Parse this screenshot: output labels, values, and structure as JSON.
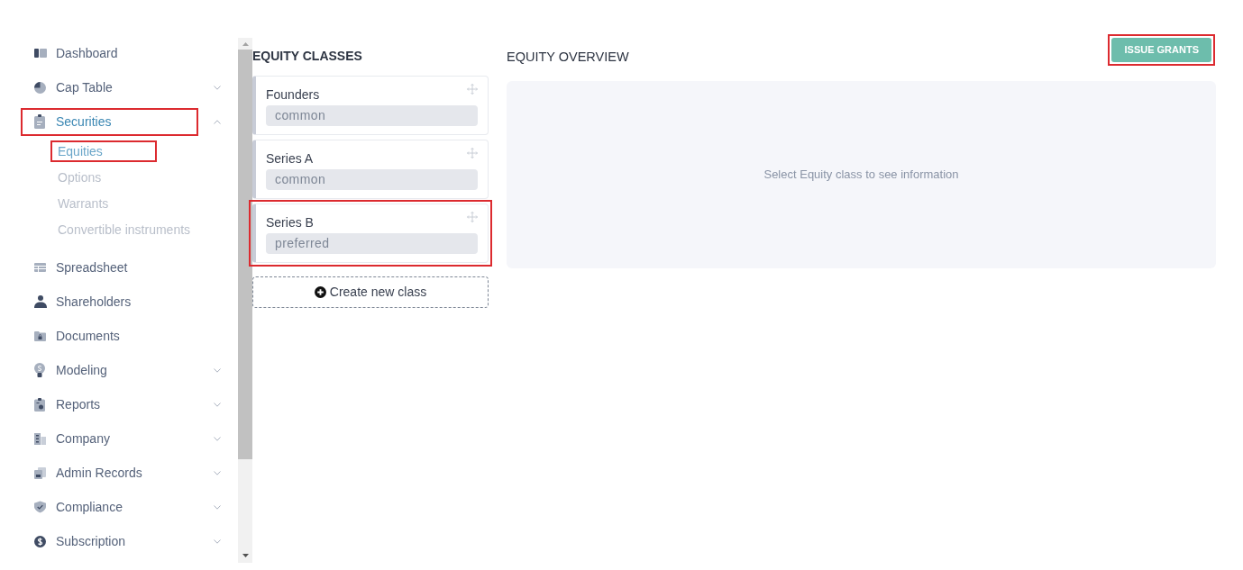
{
  "sidebar": {
    "items": [
      {
        "label": "Dashboard",
        "kind": "link",
        "selected": false,
        "highlighted": false
      },
      {
        "label": "Cap Table",
        "kind": "group",
        "expanded": false,
        "selected": false,
        "highlighted": false
      },
      {
        "label": "Securities",
        "kind": "group",
        "expanded": true,
        "selected": true,
        "highlighted": true,
        "children": [
          {
            "label": "Equities",
            "selected": true,
            "highlighted": true
          },
          {
            "label": "Options",
            "selected": false,
            "highlighted": false
          },
          {
            "label": "Warrants",
            "selected": false,
            "highlighted": false
          },
          {
            "label": "Convertible instruments",
            "selected": false,
            "highlighted": false
          }
        ]
      },
      {
        "label": "Spreadsheet",
        "kind": "link",
        "selected": false,
        "highlighted": false
      },
      {
        "label": "Shareholders",
        "kind": "link",
        "selected": false,
        "highlighted": false
      },
      {
        "label": "Documents",
        "kind": "link",
        "selected": false,
        "highlighted": false
      },
      {
        "label": "Modeling",
        "kind": "group",
        "expanded": false,
        "selected": false,
        "highlighted": false
      },
      {
        "label": "Reports",
        "kind": "group",
        "expanded": false,
        "selected": false,
        "highlighted": false
      },
      {
        "label": "Company",
        "kind": "group",
        "expanded": false,
        "selected": false,
        "highlighted": false
      },
      {
        "label": "Admin Records",
        "kind": "group",
        "expanded": false,
        "selected": false,
        "highlighted": false
      },
      {
        "label": "Compliance",
        "kind": "group",
        "expanded": false,
        "selected": false,
        "highlighted": false
      },
      {
        "label": "Subscription",
        "kind": "group",
        "expanded": false,
        "selected": false,
        "highlighted": false
      }
    ]
  },
  "equity_classes": {
    "title": "EQUITY CLASSES",
    "classes": [
      {
        "name": "Founders",
        "type": "common",
        "highlighted": false
      },
      {
        "name": "Series A",
        "type": "common",
        "highlighted": false
      },
      {
        "name": "Series B",
        "type": "preferred",
        "highlighted": true
      }
    ],
    "create_button": {
      "label": "Create new class"
    }
  },
  "equity_overview": {
    "title": "EQUITY OVERVIEW",
    "action_button": {
      "label": "ISSUE GRANTS",
      "highlighted": true
    },
    "empty_message": "Select Equity class to see information"
  }
}
